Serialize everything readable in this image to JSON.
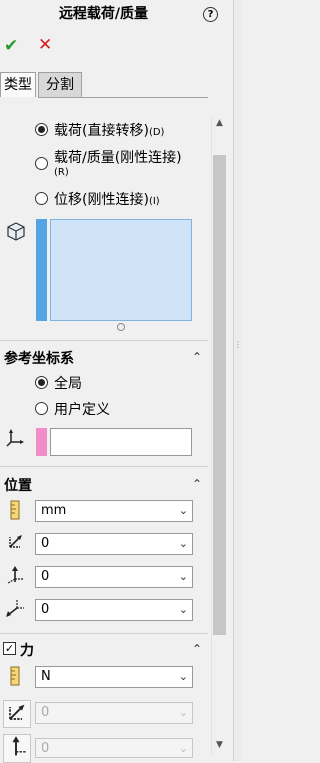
{
  "header": {
    "title": "远程载荷/质量",
    "help_label": "?"
  },
  "actions": {
    "ok": "✔",
    "cancel": "✕"
  },
  "tabs": {
    "type_label": "类型",
    "split_label": "分割"
  },
  "type_section": {
    "options": [
      {
        "label": "载荷(直接转移)",
        "accel": "(D)",
        "selected": true
      },
      {
        "label": "载荷/质量(刚性连接)",
        "accel": "(R)",
        "selected": false
      },
      {
        "label": "位移(刚性连接)",
        "accel": "(I)",
        "selected": false
      }
    ]
  },
  "coord_section": {
    "title": "参考坐标系",
    "options": [
      {
        "label": "全局",
        "selected": true
      },
      {
        "label": "用户定义",
        "selected": false
      }
    ]
  },
  "position_section": {
    "title": "位置",
    "unit": "mm",
    "x": "0",
    "y": "0",
    "z": "0"
  },
  "force_section": {
    "title": "力",
    "checked": true,
    "unit": "N",
    "x": "0",
    "y": "0"
  },
  "colors": {
    "accent_blue": "#55a5e6",
    "selection_fill": "#cfe4f7",
    "ref_pink": "#f28dc8",
    "ok_green": "#2e9a2e",
    "cancel_red": "#d41c1c"
  },
  "icons": [
    "help-icon",
    "ok-icon",
    "cancel-icon",
    "cube-icon",
    "axis-icon",
    "ruler-icon",
    "x-axis-icon",
    "y-axis-icon",
    "z-axis-icon",
    "collapse-icon",
    "checkbox-icon",
    "scroll-up-icon",
    "scroll-down-icon"
  ]
}
